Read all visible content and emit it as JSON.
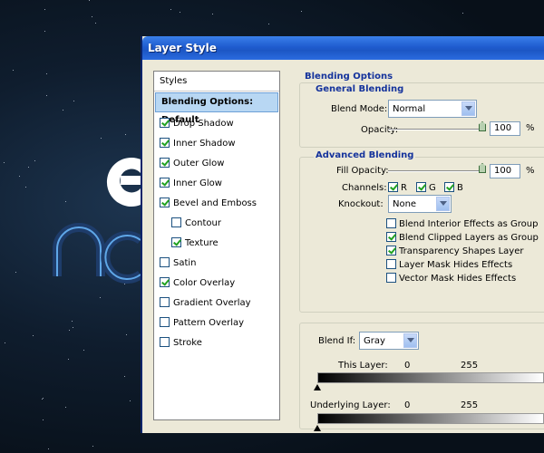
{
  "window": {
    "title": "Layer Style"
  },
  "styles_list": {
    "header": "Styles",
    "items": [
      {
        "label": "Blending Options: Default",
        "selected": true,
        "has_checkbox": false,
        "checked": false,
        "indent": false
      },
      {
        "label": "Drop Shadow",
        "has_checkbox": true,
        "checked": true,
        "indent": false
      },
      {
        "label": "Inner Shadow",
        "has_checkbox": true,
        "checked": true,
        "indent": false
      },
      {
        "label": "Outer Glow",
        "has_checkbox": true,
        "checked": true,
        "indent": false
      },
      {
        "label": "Inner Glow",
        "has_checkbox": true,
        "checked": true,
        "indent": false
      },
      {
        "label": "Bevel and Emboss",
        "has_checkbox": true,
        "checked": true,
        "indent": false
      },
      {
        "label": "Contour",
        "has_checkbox": true,
        "checked": false,
        "indent": true
      },
      {
        "label": "Texture",
        "has_checkbox": true,
        "checked": true,
        "indent": true
      },
      {
        "label": "Satin",
        "has_checkbox": true,
        "checked": false,
        "indent": false
      },
      {
        "label": "Color Overlay",
        "has_checkbox": true,
        "checked": true,
        "indent": false
      },
      {
        "label": "Gradient Overlay",
        "has_checkbox": true,
        "checked": false,
        "indent": false
      },
      {
        "label": "Pattern Overlay",
        "has_checkbox": true,
        "checked": false,
        "indent": false
      },
      {
        "label": "Stroke",
        "has_checkbox": true,
        "checked": false,
        "indent": false
      }
    ]
  },
  "blending": {
    "title": "Blending Options",
    "general": {
      "title": "General Blending",
      "blend_mode_label": "Blend Mode:",
      "blend_mode_value": "Normal",
      "opacity_label": "Opacity:",
      "opacity_value": "100",
      "opacity_unit": "%",
      "opacity_level": 1.0
    },
    "advanced": {
      "title": "Advanced Blending",
      "fill_opacity_label": "Fill Opacity:",
      "fill_opacity_value": "100",
      "fill_opacity_unit": "%",
      "fill_opacity_level": 1.0,
      "channels_label": "Channels:",
      "channels": [
        {
          "label": "R",
          "checked": true
        },
        {
          "label": "G",
          "checked": true
        },
        {
          "label": "B",
          "checked": true
        }
      ],
      "knockout_label": "Knockout:",
      "knockout_value": "None",
      "options": [
        {
          "label": "Blend Interior Effects as Group",
          "checked": false
        },
        {
          "label": "Blend Clipped Layers as Group",
          "checked": true
        },
        {
          "label": "Transparency Shapes Layer",
          "checked": true
        },
        {
          "label": "Layer Mask Hides Effects",
          "checked": false
        },
        {
          "label": "Vector Mask Hides Effects",
          "checked": false
        }
      ]
    },
    "blend_if": {
      "label": "Blend If:",
      "value": "Gray",
      "this_layer_label": "This Layer:",
      "this_layer_min": "0",
      "this_layer_max": "255",
      "underlying_label": "Underlying Layer:",
      "underlying_min": "0",
      "underlying_max": "255"
    }
  },
  "colors": {
    "accent": "#15339c",
    "titlebar": "#1f5ccf",
    "selected": "#b8d7f3"
  }
}
